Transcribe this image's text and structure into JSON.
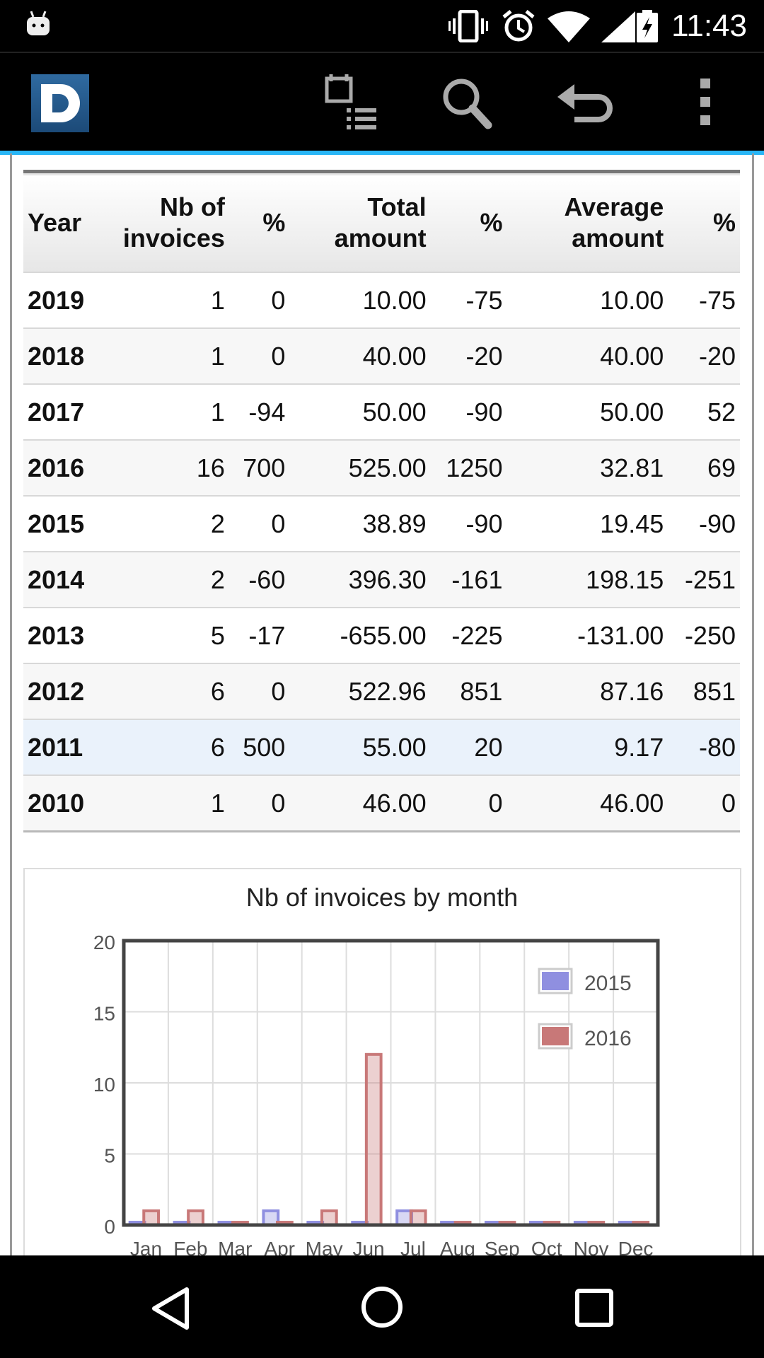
{
  "status_bar": {
    "time": "11:43",
    "icons": [
      "android-icon",
      "vibrate-icon",
      "alarm-icon",
      "wifi-icon",
      "battery-charging-icon"
    ]
  },
  "toolbar": {
    "logo_letter": "D",
    "icons": [
      "calendar-list-icon",
      "search-icon",
      "back-arrow-icon",
      "more-vert-icon"
    ],
    "accent_color": "#29b6f6"
  },
  "table": {
    "headers": {
      "year": "Year",
      "nb_line1": "Nb of",
      "nb_line2": "invoices",
      "pct1": "%",
      "total_line1": "Total",
      "total_line2": "amount",
      "pct2": "%",
      "avg_line1": "Average",
      "avg_line2": "amount",
      "pct3": "%"
    },
    "rows": [
      {
        "year": "2019",
        "nb": "1",
        "pct_nb": "0",
        "total": "10.00",
        "pct_total": "-75",
        "avg": "10.00",
        "pct_avg": "-75"
      },
      {
        "year": "2018",
        "nb": "1",
        "pct_nb": "0",
        "total": "40.00",
        "pct_total": "-20",
        "avg": "40.00",
        "pct_avg": "-20"
      },
      {
        "year": "2017",
        "nb": "1",
        "pct_nb": "-94",
        "total": "50.00",
        "pct_total": "-90",
        "avg": "50.00",
        "pct_avg": "52"
      },
      {
        "year": "2016",
        "nb": "16",
        "pct_nb": "700",
        "total": "525.00",
        "pct_total": "1250",
        "avg": "32.81",
        "pct_avg": "69"
      },
      {
        "year": "2015",
        "nb": "2",
        "pct_nb": "0",
        "total": "38.89",
        "pct_total": "-90",
        "avg": "19.45",
        "pct_avg": "-90"
      },
      {
        "year": "2014",
        "nb": "2",
        "pct_nb": "-60",
        "total": "396.30",
        "pct_total": "-161",
        "avg": "198.15",
        "pct_avg": "-251"
      },
      {
        "year": "2013",
        "nb": "5",
        "pct_nb": "-17",
        "total": "-655.00",
        "pct_total": "-225",
        "avg": "-131.00",
        "pct_avg": "-250"
      },
      {
        "year": "2012",
        "nb": "6",
        "pct_nb": "0",
        "total": "522.96",
        "pct_total": "851",
        "avg": "87.16",
        "pct_avg": "851"
      },
      {
        "year": "2011",
        "nb": "6",
        "pct_nb": "500",
        "total": "55.00",
        "pct_total": "20",
        "avg": "9.17",
        "pct_avg": "-80"
      },
      {
        "year": "2010",
        "nb": "1",
        "pct_nb": "0",
        "total": "46.00",
        "pct_total": "0",
        "avg": "46.00",
        "pct_avg": "0"
      }
    ],
    "colors": {
      "positive": "#1a8a1a",
      "negative": "#e01818",
      "year": "#101060"
    }
  },
  "chart_data": {
    "type": "bar",
    "title": "Nb of invoices by month",
    "categories": [
      "Jan",
      "Feb",
      "Mar",
      "Apr",
      "May",
      "Jun",
      "Jul",
      "Aug",
      "Sep",
      "Oct",
      "Nov",
      "Dec"
    ],
    "series": [
      {
        "name": "2015",
        "color": "#8f8fe0",
        "values": [
          0,
          0,
          0,
          1,
          0,
          0,
          1,
          0,
          0,
          0,
          0,
          0
        ]
      },
      {
        "name": "2016",
        "color": "#c87878",
        "values": [
          1,
          1,
          0,
          0,
          1,
          12,
          1,
          0,
          0,
          0,
          0,
          0
        ]
      }
    ],
    "yticks": [
      "0",
      "5",
      "10",
      "15",
      "20"
    ],
    "ylim": [
      0,
      20
    ],
    "grid": true,
    "legend_position": "top-right"
  },
  "nav_bar": {
    "icons": [
      "nav-back-icon",
      "nav-home-icon",
      "nav-recents-icon"
    ]
  }
}
